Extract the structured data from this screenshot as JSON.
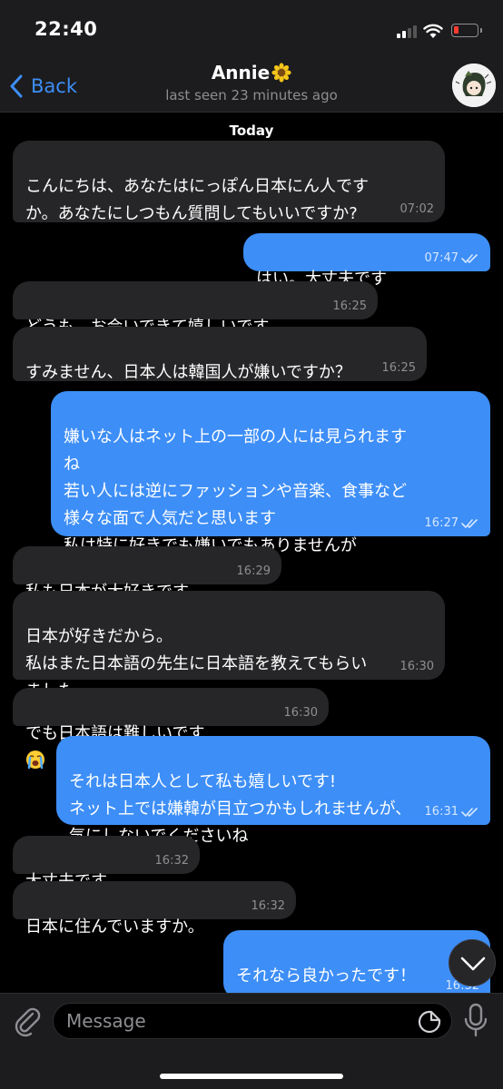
{
  "status_bar": {
    "time": "22:40"
  },
  "header": {
    "back_label": "Back",
    "contact_name": "Annie",
    "last_seen": "last seen 23 minutes ago"
  },
  "chat": {
    "date_label": "Today",
    "messages": [
      {
        "direction": "incoming",
        "text": "こんにちは、あなたはにっぽん日本にん人です\nか。あなたにしつもん質問してもいいですか?",
        "time": "07:02"
      },
      {
        "direction": "outgoing",
        "text": "はい。大丈夫です",
        "time": "07:47",
        "read": true
      },
      {
        "direction": "incoming",
        "text": "どうも、お会いできて嬉しいです",
        "time": "16:25"
      },
      {
        "direction": "incoming",
        "text": "すみません、日本人は韓国人が嫌いですか？",
        "time": "16:25"
      },
      {
        "direction": "outgoing",
        "text": "嫌いな人はネット上の一部の人には見られます\nね\n若い人には逆にファッションや音楽、食事など\n様々な面で人気だと思います\n私は特に好きでも嫌いでもありませんが",
        "time": "16:27",
        "read": true
      },
      {
        "direction": "incoming",
        "text": "私も日本が大好きです",
        "time": "16:29"
      },
      {
        "direction": "incoming",
        "text": "日本が好きだから。\n私はまた日本語の先生に日本語を教えてもらい\nました",
        "time": "16:30"
      },
      {
        "direction": "incoming",
        "text": "でも日本語は難しいです",
        "emoji": "loudly-crying-face",
        "time": "16:30"
      },
      {
        "direction": "outgoing",
        "text": "それは日本人として私も嬉しいです!\nネット上では嫌韓が目立つかもしれませんが、\n気にしないでくださいね",
        "time": "16:31",
        "read": true
      },
      {
        "direction": "incoming",
        "text": "大丈夫です。",
        "time": "16:32"
      },
      {
        "direction": "incoming",
        "text": "日本に住んでいますか。",
        "time": "16:32"
      },
      {
        "direction": "outgoing",
        "text": "それなら良かったです！\n日本に住んでますよ",
        "time": "16:32"
      }
    ]
  },
  "input_bar": {
    "placeholder": "Message"
  },
  "icons": {
    "back": "chevron-left-icon",
    "scroll_down": "chevron-down-icon",
    "attach": "paperclip-icon",
    "sticker": "sticker-icon",
    "mic": "microphone-icon"
  },
  "colors": {
    "accent": "#3d8ef7",
    "incoming_bubble": "#262628",
    "outgoing_bubble": "#3d8ef7",
    "background": "#000000",
    "bar": "#1c1c1e"
  }
}
